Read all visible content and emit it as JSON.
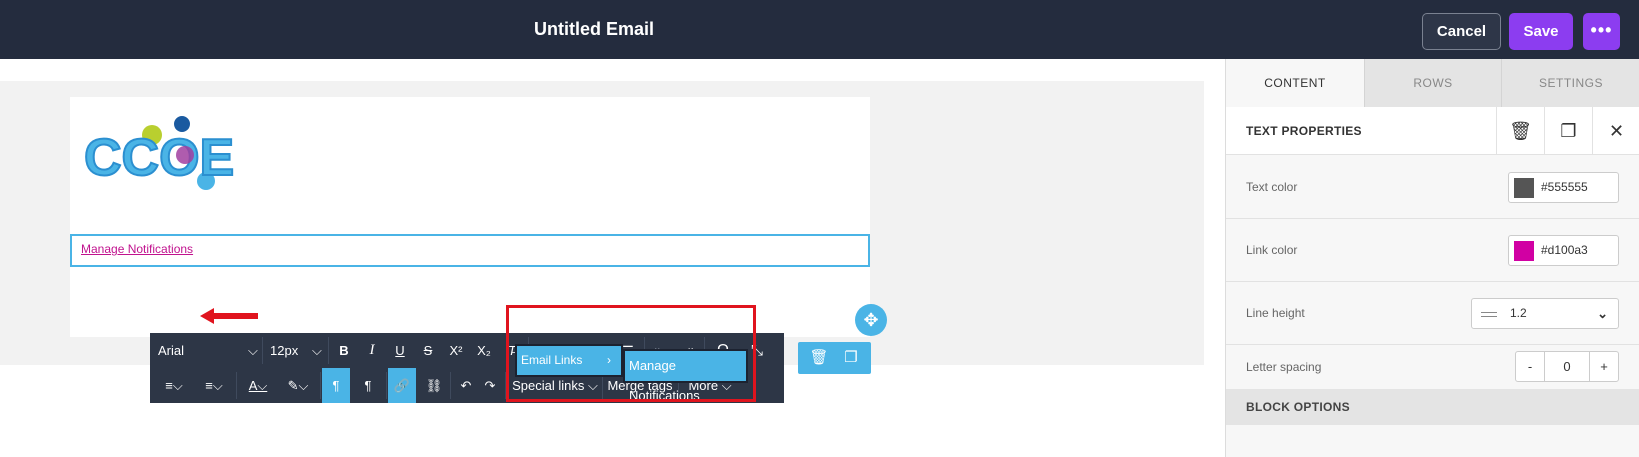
{
  "header": {
    "title": "Untitled Email",
    "cancel_label": "Cancel",
    "save_label": "Save",
    "more_label": "•••"
  },
  "editor": {
    "logo_text": "CCOE",
    "link_text": "Manage Notifications",
    "toolbar": {
      "font_family": "Arial",
      "font_size": "12px",
      "special_links_label": "Special links",
      "merge_tags_label": "Merge tags",
      "more_label": "More"
    },
    "dropdown": {
      "category": "Email Links",
      "item": "Manage Notifications"
    }
  },
  "sidebar": {
    "tabs": [
      "CONTENT",
      "ROWS",
      "SETTINGS"
    ],
    "section_title": "TEXT PROPERTIES",
    "text_color_label": "Text color",
    "text_color_value": "#555555",
    "link_color_label": "Link color",
    "link_color_value": "#d100a3",
    "line_height_label": "Line height",
    "line_height_value": "1.2",
    "letter_spacing_label": "Letter spacing",
    "letter_spacing_value": "0",
    "block_options_label": "BLOCK OPTIONS"
  },
  "colors": {
    "accent": "#8c3df0",
    "selection": "#4ab4e6",
    "link": "#c1128e",
    "topbar": "#242c3e"
  }
}
